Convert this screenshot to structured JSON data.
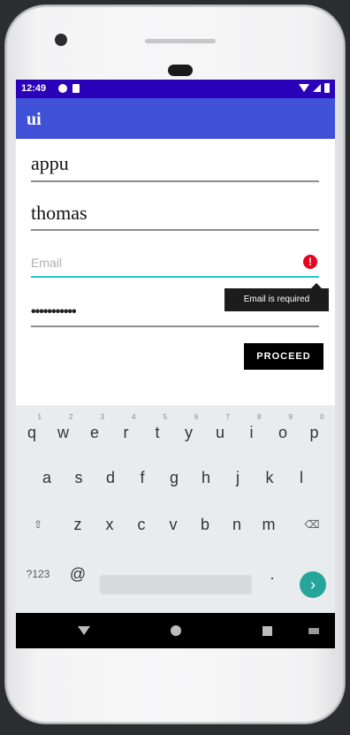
{
  "status_bar": {
    "time": "12:49",
    "left_icons": [
      "notification-icon",
      "sd-card-icon"
    ],
    "right_icons": [
      "wifi-icon",
      "signal-icon",
      "battery-icon"
    ]
  },
  "app_bar": {
    "title": "ui"
  },
  "form": {
    "first_name_value": "appu",
    "last_name_value": "thomas",
    "email_placeholder": "Email",
    "email_error": "Email is required",
    "email_error_icon": "!",
    "password_mask": "•••••••••••",
    "proceed_label": "PROCEED"
  },
  "keyboard": {
    "row1": [
      {
        "k": "q",
        "n": "1"
      },
      {
        "k": "w",
        "n": "2"
      },
      {
        "k": "e",
        "n": "3"
      },
      {
        "k": "r",
        "n": "4"
      },
      {
        "k": "t",
        "n": "5"
      },
      {
        "k": "y",
        "n": "6"
      },
      {
        "k": "u",
        "n": "7"
      },
      {
        "k": "i",
        "n": "8"
      },
      {
        "k": "o",
        "n": "9"
      },
      {
        "k": "p",
        "n": "0"
      }
    ],
    "row2": [
      "a",
      "s",
      "d",
      "f",
      "g",
      "h",
      "j",
      "k",
      "l"
    ],
    "row3": [
      "z",
      "x",
      "c",
      "v",
      "b",
      "n",
      "m"
    ],
    "shift_symbol": "⇧",
    "delete_symbol": "⌫",
    "symbols_label": "?123",
    "at_label": "@",
    "period_label": ".",
    "go_symbol": "›"
  },
  "colors": {
    "status_bar": "#2a00b8",
    "app_bar": "#3f51d6",
    "accent": "#26c6c6",
    "error": "#e8001c",
    "go_key": "#26a69a"
  }
}
